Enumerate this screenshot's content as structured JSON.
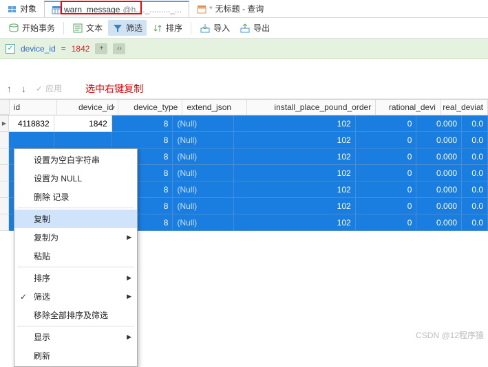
{
  "tabs": {
    "objects": "对象",
    "main": "warn_message",
    "main_suffix": "@h...._........._...",
    "untitled_prefix": "*",
    "untitled": "无标题 - 查询"
  },
  "toolbar": {
    "begin_tx": "开始事务",
    "text": "文本",
    "filter": "筛选",
    "sort": "排序",
    "import": "导入",
    "export": "导出"
  },
  "filter": {
    "field": "device_id",
    "op": "=",
    "value": "1842",
    "plus": "+",
    "code": "‹›"
  },
  "actions": {
    "up": "↑",
    "down": "↓",
    "apply": "应用",
    "note": "选中右键复制"
  },
  "columns": [
    "id",
    "device_id",
    "device_type",
    "extend_json",
    "install_place_pound_order",
    "rational_devi",
    "real_deviat"
  ],
  "rows": [
    {
      "id": "4118832",
      "device_id": "1842",
      "device_type": "8",
      "extend_json": "(Null)",
      "install": "102",
      "rational": "0",
      "real": "0.000",
      "realdev": "0.0"
    },
    {
      "id": "",
      "device_id": "",
      "device_type": "8",
      "extend_json": "(Null)",
      "install": "102",
      "rational": "0",
      "real": "0.000",
      "realdev": "0.0"
    },
    {
      "id": "",
      "device_id": "",
      "device_type": "8",
      "extend_json": "(Null)",
      "install": "102",
      "rational": "0",
      "real": "0.000",
      "realdev": "0.0"
    },
    {
      "id": "",
      "device_id": "",
      "device_type": "8",
      "extend_json": "(Null)",
      "install": "102",
      "rational": "0",
      "real": "0.000",
      "realdev": "0.0"
    },
    {
      "id": "",
      "device_id": "",
      "device_type": "8",
      "extend_json": "(Null)",
      "install": "102",
      "rational": "0",
      "real": "0.000",
      "realdev": "0.0"
    },
    {
      "id": "",
      "device_id": "",
      "device_type": "8",
      "extend_json": "(Null)",
      "install": "102",
      "rational": "0",
      "real": "0.000",
      "realdev": "0.0"
    },
    {
      "id": "",
      "device_id": "",
      "device_type": "8",
      "extend_json": "(Null)",
      "install": "102",
      "rational": "0",
      "real": "0.000",
      "realdev": "0.0"
    }
  ],
  "context_menu": {
    "items": [
      {
        "label": "设置为空白字符串",
        "sub": false
      },
      {
        "label": "设置为 NULL",
        "sub": false
      },
      {
        "label": "删除 记录",
        "sub": false,
        "sep": true
      },
      {
        "label": "复制",
        "sub": false,
        "sel": true
      },
      {
        "label": "复制为",
        "sub": true
      },
      {
        "label": "粘贴",
        "sub": false,
        "sep": true
      },
      {
        "label": "排序",
        "sub": true
      },
      {
        "label": "筛选",
        "sub": true,
        "chk": true
      },
      {
        "label": "移除全部排序及筛选",
        "sub": false,
        "sep": true
      },
      {
        "label": "显示",
        "sub": true
      },
      {
        "label": "刷新",
        "sub": false
      }
    ]
  },
  "watermark": "CSDN @12程序猿"
}
